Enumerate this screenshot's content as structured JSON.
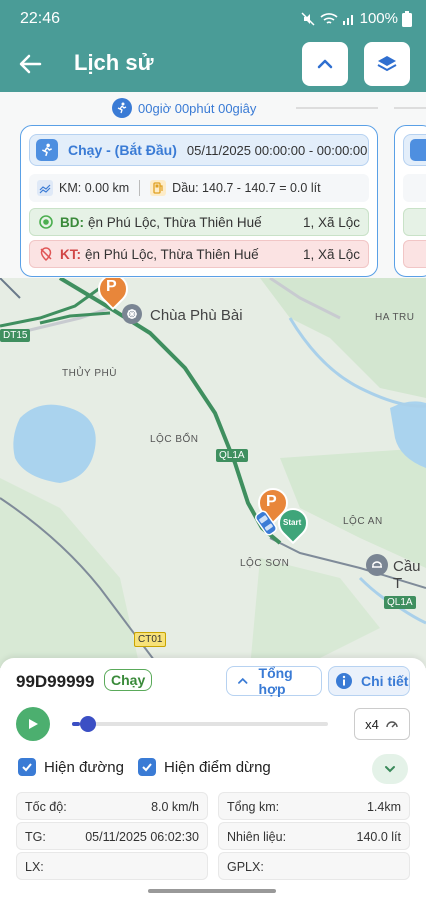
{
  "status_bar": {
    "time": "22:46",
    "battery": "100%"
  },
  "app_bar": {
    "title": "Lịch sử",
    "back_icon": "arrow-left-icon",
    "collapse_icon": "chevron-up-icon",
    "layers_icon": "layers-icon"
  },
  "timeline": {
    "duration": "00giờ 00phút 00giây",
    "card": {
      "mode": "Chạy - (Bắt Đầu)",
      "range": "05/11/2025 00:00:00 - 00:00:00",
      "km": "KM: 0.00 km",
      "fuel": "Dầu: 140.7 - 140.7 = 0.0 lít",
      "start_label": "BD:",
      "start_address": "ện Phú Lộc, Thừa Thiên Huế",
      "start_tail": "1, Xã Lộc",
      "end_label": "KT:",
      "end_address": "ện Phú Lộc, Thừa Thiên Huế",
      "end_tail": "1, Xã Lộc"
    }
  },
  "map": {
    "labels": {
      "pagoda": "Chùa Phù Bài",
      "ha_tru": "HA TRU",
      "thuy_phu": "THỦY PHÙ",
      "loc_bon": "LỘC BỔN",
      "loc_an": "LỘC AN",
      "loc_son": "LỘC SƠN",
      "cau_t": "Cầu T",
      "ql1a_top": "QL1A",
      "ql1a_bottom": "QL1A",
      "dt15": "DT15",
      "ct01": "CT01",
      "start_marker": "Start",
      "parking_marker": "P"
    }
  },
  "vehicle": {
    "plate": "99D99999",
    "state": "Chạy",
    "summary_button": "Tổng hợp",
    "detail_button": "Chi tiết",
    "playback_progress": 0.03,
    "speed_multiplier": "x4",
    "show_route": "Hiện đường",
    "show_stops": "Hiện điểm dừng",
    "info": {
      "speed_label": "Tốc độ:",
      "speed_value": "8.0 km/h",
      "total_km_label": "Tổng km:",
      "total_km_value": "1.4km",
      "time_label": "TG:",
      "time_value": "05/11/2025 06:02:30",
      "fuel_label": "Nhiên liệu:",
      "fuel_value": "140.0 lít",
      "driver_label": "LX:",
      "driver_value": "",
      "license_label": "GPLX:",
      "license_value": ""
    }
  },
  "colors": {
    "header": "#4a9c97",
    "accent_blue": "#3a7bd5",
    "route_green": "#3f8f5f",
    "play_green": "#4caf6f"
  }
}
